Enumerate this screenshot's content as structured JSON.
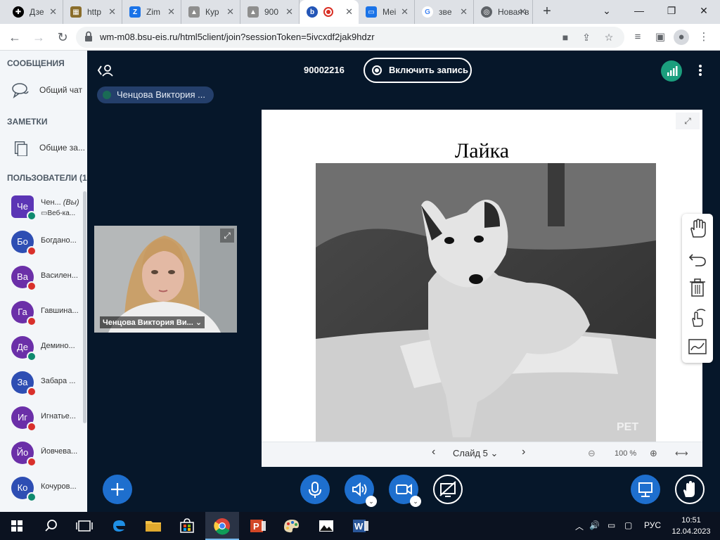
{
  "browser": {
    "tabs": [
      {
        "label": "Дзе",
        "color": "#000000"
      },
      {
        "label": "http",
        "color": "#8a6d2b"
      },
      {
        "label": "Zim",
        "color": "#1a73e8"
      },
      {
        "label": "Кур",
        "color": "#6b6b6b"
      },
      {
        "label": "900",
        "color": "#6b6b6b"
      },
      {
        "label": "",
        "color": "#2456b7"
      },
      {
        "label": "Mei",
        "color": "#1a73e8"
      },
      {
        "label": "звe",
        "color": "#ffffff"
      },
      {
        "label": "Новая в",
        "color": "#5f6368"
      }
    ],
    "url": "wm-m08.bsu-eis.ru/html5client/join?sessionToken=5ivcxdf2jak9hdzr"
  },
  "sidebar": {
    "messages_title": "СООБЩЕНИЯ",
    "public_chat": "Общий чат",
    "notes_title": "ЗАМЕТКИ",
    "shared_notes": "Общие за...",
    "users_title": "ПОЛЬЗОВАТЕЛИ (18)",
    "users": [
      {
        "initials": "Че",
        "name": "Чен...",
        "you": "(Вы)",
        "sub": "Веб-ка...",
        "color": "#5b35b5",
        "badge": "#0e8a6e"
      },
      {
        "initials": "Бо",
        "name": "Богдано...",
        "color": "#2e4eb3",
        "badge": "#d9302b"
      },
      {
        "initials": "Ва",
        "name": "Василен...",
        "color": "#6b2fa8",
        "badge": "#d9302b"
      },
      {
        "initials": "Га",
        "name": "Гавшина...",
        "color": "#6b2fa8",
        "badge": "#d9302b"
      },
      {
        "initials": "Де",
        "name": "Демино...",
        "color": "#6b2fa8",
        "badge": "#0e8a6e"
      },
      {
        "initials": "За",
        "name": "Забара ...",
        "color": "#2e4eb3",
        "badge": "#d9302b"
      },
      {
        "initials": "Иг",
        "name": "Игнатье...",
        "color": "#6b2fa8",
        "badge": "#d9302b"
      },
      {
        "initials": "Йо",
        "name": "Йовчева...",
        "color": "#6b2fa8",
        "badge": "#d9302b"
      },
      {
        "initials": "Ко",
        "name": "Кочуров...",
        "color": "#2e4eb3",
        "badge": "#0e8a6e"
      }
    ]
  },
  "meeting": {
    "id": "90002216",
    "record_label": "Включить запись",
    "talker": "Ченцова Виктория ...",
    "webcam_label": "Ченцова Виктория Ви..."
  },
  "slide": {
    "title": "Лайка",
    "nav_label": "Слайд 5",
    "zoom": "100 %",
    "watermark": "PET"
  },
  "taskbar": {
    "time": "10:51",
    "date": "12.04.2023",
    "lang": "РУС"
  }
}
